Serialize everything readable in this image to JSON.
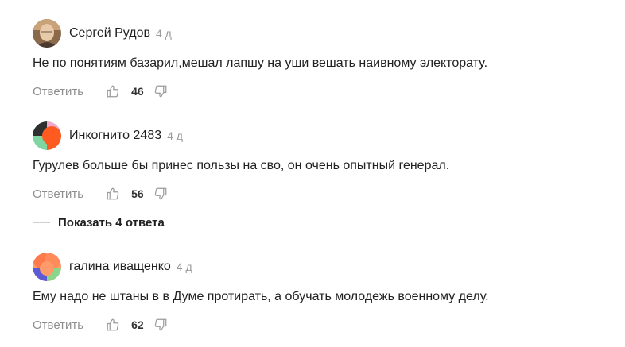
{
  "comments": [
    {
      "author": "Сергей Рудов",
      "time": "4 д",
      "text": "Не по понятиям базарил,мешал лапшу на уши вешать наивному электорату.",
      "reply_label": "Ответить",
      "likes": "46",
      "avatar": "photo-avatar"
    },
    {
      "author": "Инкогнито 2483",
      "time": "4 д",
      "text": "Гурулев больше бы принес пользы на сво, он очень опытный генерал.",
      "reply_label": "Ответить",
      "likes": "56",
      "avatar": "generated-avatar",
      "show_replies": "Показать 4 ответа"
    },
    {
      "author": "галина иващенко",
      "time": "4 д",
      "text": "Ему надо не штаны в в Думе протирать, а обучать молодежь военному делу.",
      "reply_label": "Ответить",
      "likes": "62",
      "avatar": "generated-avatar"
    }
  ],
  "colors": {
    "avatar2": [
      "#2f2f2f",
      "#ff5a1f",
      "#7fd6a0",
      "#f4a6c8"
    ],
    "avatar3": [
      "#ff7a4a",
      "#5b5bd6",
      "#8bd68b",
      "#ff9a6a"
    ]
  }
}
